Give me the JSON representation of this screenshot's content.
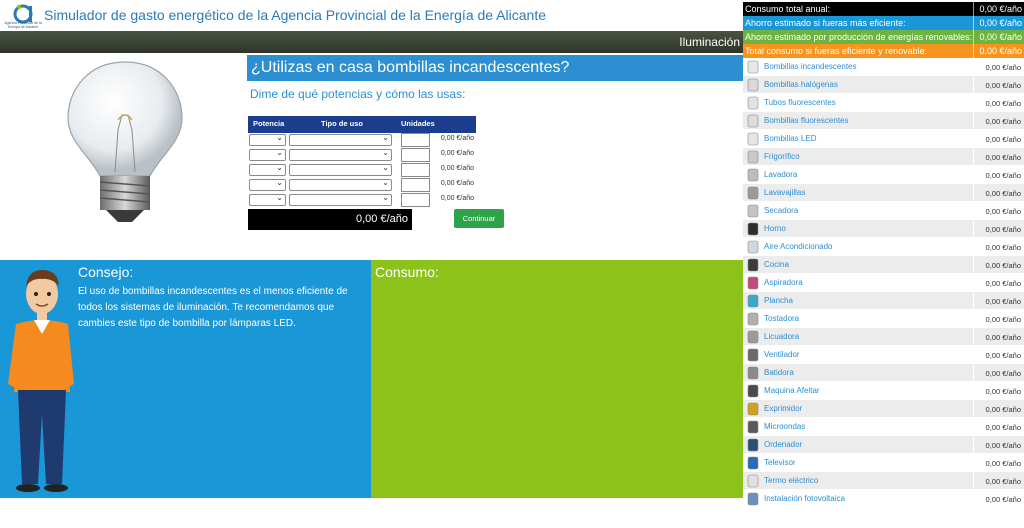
{
  "header": {
    "logo_text": "Agencia Provincial de la Energía de Alicante",
    "title": "Simulador de gasto energético de la Agencia Provincial de la Energía de Alicante",
    "nav_label": "Iluminación"
  },
  "question": {
    "title": "¿Utilizas en casa bombillas incandescentes?",
    "subtitle": "Dime de qué potencias y cómo las usas:",
    "col_potencia": "Potencia",
    "col_tipo": "Tipo de uso",
    "col_unidades": "Unidades",
    "rows": [
      {
        "value": "0,00 €/año"
      },
      {
        "value": "0,00 €/año"
      },
      {
        "value": "0,00 €/año"
      },
      {
        "value": "0,00 €/año"
      },
      {
        "value": "0,00 €/año"
      }
    ],
    "total": "0,00 €/año",
    "continue_label": "Continuar"
  },
  "consejo": {
    "title": "Consejo:",
    "text": "El uso de bombillas incandescentes es el menos eficiente de todos los sistemas de iluminación. Te recomendamos que cambies este tipo de bombilla por lámparas LED."
  },
  "consumo": {
    "title": "Consumo:"
  },
  "summary": [
    {
      "label": "Consumo total anual:",
      "value": "0,00 €/año",
      "color": "#000000"
    },
    {
      "label": "Ahorro estimado si fueras más eficiente:",
      "value": "0,00 €/año",
      "color": "#1a97d6"
    },
    {
      "label": "Ahorro estimado por producción de energías renovables:",
      "value": "0,00 €/año",
      "color": "#6cb33f"
    },
    {
      "label": "Total consumo si fueras eficiente y renovable:",
      "value": "0,00 €/año",
      "color": "#f7941d"
    }
  ],
  "appliances": [
    {
      "name": "Bombillas incandescentes",
      "value": "0,00 €/año",
      "icon": "bulb-icon"
    },
    {
      "name": "Bombillas halógenas",
      "value": "0,00 €/año",
      "icon": "halogen-icon"
    },
    {
      "name": "Tubos fluorescentes",
      "value": "0,00 €/año",
      "icon": "tube-icon"
    },
    {
      "name": "Bombillas fluorescentes",
      "value": "0,00 €/año",
      "icon": "cfl-icon"
    },
    {
      "name": "Bombillas LED",
      "value": "0,00 €/año",
      "icon": "led-icon"
    },
    {
      "name": "Frigorífico",
      "value": "0,00 €/año",
      "icon": "fridge-icon"
    },
    {
      "name": "Lavadora",
      "value": "0,00 €/año",
      "icon": "washer-icon"
    },
    {
      "name": "Lavavajillas",
      "value": "0,00 €/año",
      "icon": "dishwasher-icon"
    },
    {
      "name": "Secadora",
      "value": "0,00 €/año",
      "icon": "dryer-icon"
    },
    {
      "name": "Horno",
      "value": "0,00 €/año",
      "icon": "oven-icon"
    },
    {
      "name": "Aire Acondicionado",
      "value": "0,00 €/año",
      "icon": "ac-icon"
    },
    {
      "name": "Cocina",
      "value": "0,00 €/año",
      "icon": "stove-icon"
    },
    {
      "name": "Aspiradora",
      "value": "0,00 €/año",
      "icon": "vacuum-icon"
    },
    {
      "name": "Plancha",
      "value": "0,00 €/año",
      "icon": "iron-icon"
    },
    {
      "name": "Tostadora",
      "value": "0,00 €/año",
      "icon": "toaster-icon"
    },
    {
      "name": "Licuadora",
      "value": "0,00 €/año",
      "icon": "blender-icon"
    },
    {
      "name": "Ventilador",
      "value": "0,00 €/año",
      "icon": "fan-icon"
    },
    {
      "name": "Batidora",
      "value": "0,00 €/año",
      "icon": "mixer-icon"
    },
    {
      "name": "Maquina Afeitar",
      "value": "0,00 €/año",
      "icon": "shaver-icon"
    },
    {
      "name": "Exprimidor",
      "value": "0,00 €/año",
      "icon": "juicer-icon"
    },
    {
      "name": "Microondas",
      "value": "0,00 €/año",
      "icon": "microwave-icon"
    },
    {
      "name": "Ordenador",
      "value": "0,00 €/año",
      "icon": "computer-icon"
    },
    {
      "name": "Televisor",
      "value": "0,00 €/año",
      "icon": "tv-icon"
    },
    {
      "name": "Termo eléctrico",
      "value": "0,00 €/año",
      "icon": "water-heater-icon"
    },
    {
      "name": "Instalación fotovoltaica",
      "value": "0,00 €/año",
      "icon": "solar-panel-icon"
    }
  ]
}
